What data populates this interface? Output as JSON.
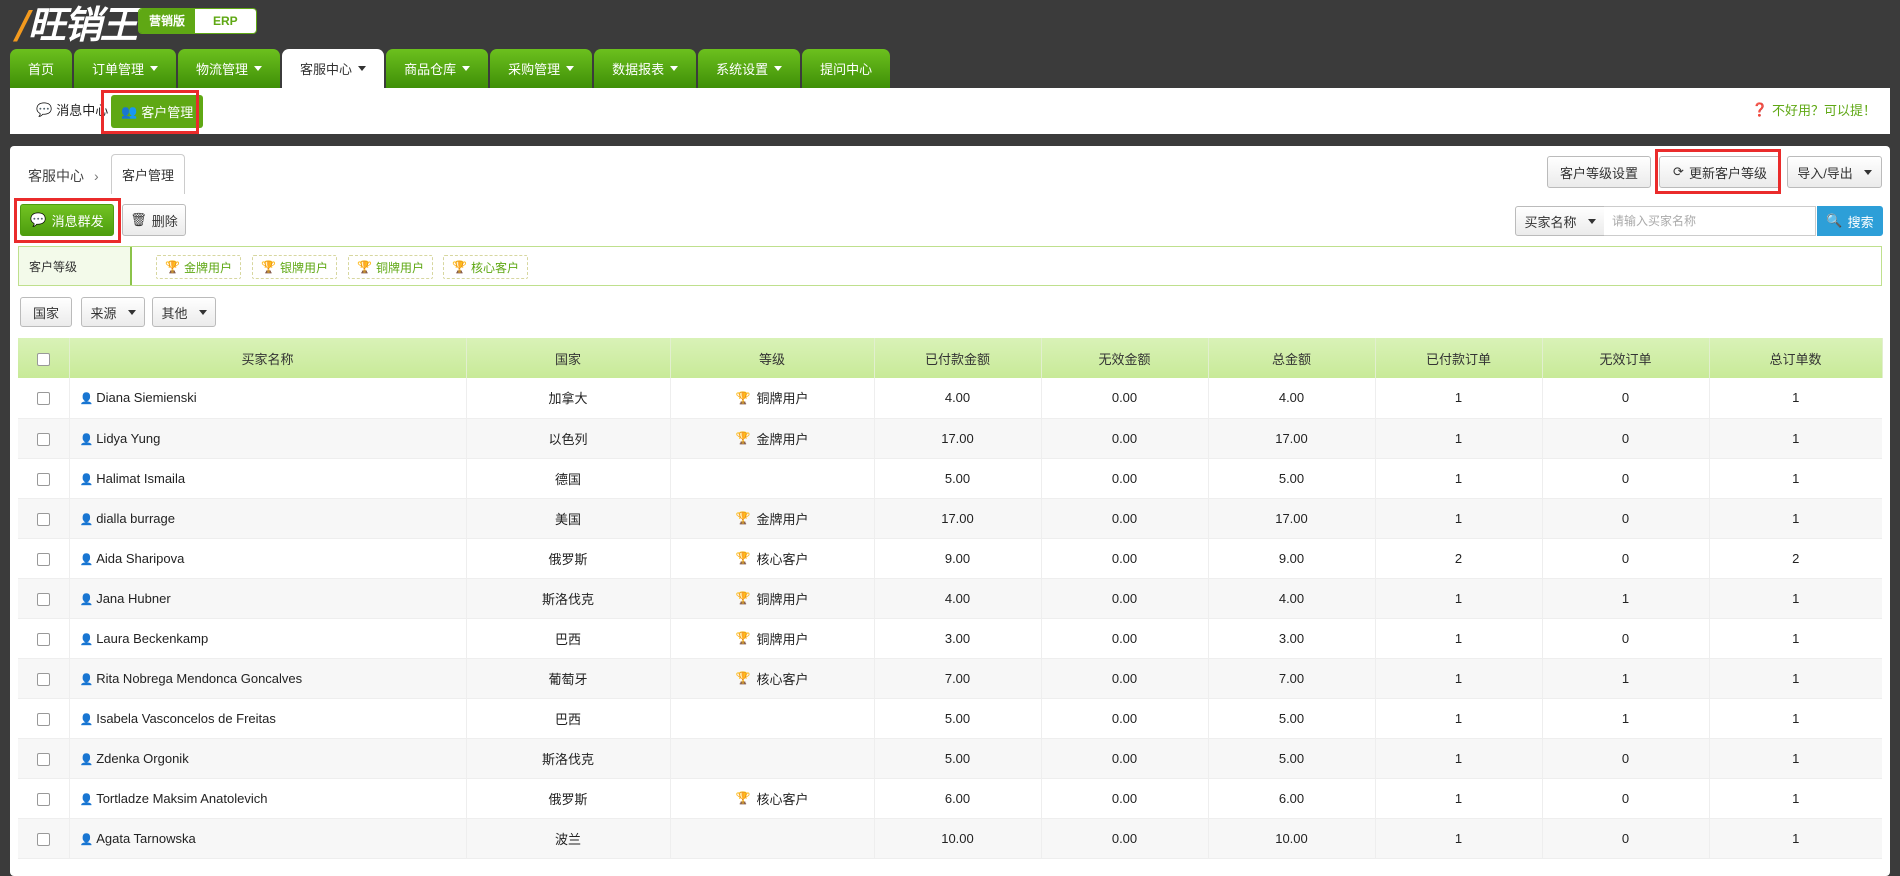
{
  "app": {
    "logo": "旺销王",
    "edition_a": "营销版",
    "edition_b": "ERP"
  },
  "nav": {
    "tabs": [
      {
        "label": "首页",
        "caret": false
      },
      {
        "label": "订单管理",
        "caret": true
      },
      {
        "label": "物流管理",
        "caret": true
      },
      {
        "label": "客服中心",
        "caret": true,
        "active": true
      },
      {
        "label": "商品仓库",
        "caret": true
      },
      {
        "label": "采购管理",
        "caret": true
      },
      {
        "label": "数据报表",
        "caret": true
      },
      {
        "label": "系统设置",
        "caret": true
      },
      {
        "label": "提问中心",
        "caret": false
      }
    ]
  },
  "subnav": {
    "message_center": "消息中心",
    "customer_mgmt": "客户管理",
    "help": "不好用？可以提！"
  },
  "panel": {
    "breadcrumb_root": "客服中心",
    "breadcrumb_sep": "›",
    "breadcrumb_tab": "客户管理",
    "btn_level_settings": "客户等级设置",
    "btn_update_level": "更新客户等级",
    "btn_import_export": "导入/导出",
    "btn_broadcast": "消息群发",
    "btn_delete": "删除",
    "search_field": "买家名称",
    "search_placeholder": "请输入买家名称",
    "btn_search": "搜索",
    "level_label": "客户等级",
    "levels": [
      "金牌用户",
      "银牌用户",
      "铜牌用户",
      "核心客户"
    ],
    "filter_country": "国家",
    "filter_source": "来源",
    "filter_other": "其他"
  },
  "table": {
    "headers": [
      "买家名称",
      "国家",
      "等级",
      "已付款金额",
      "无效金额",
      "总金额",
      "已付款订单",
      "无效订单",
      "总订单数"
    ],
    "rows": [
      [
        "Diana Siemienski",
        "加拿大",
        "铜牌用户",
        "4.00",
        "0.00",
        "4.00",
        "1",
        "0",
        "1"
      ],
      [
        "Lidya Yung",
        "以色列",
        "金牌用户",
        "17.00",
        "0.00",
        "17.00",
        "1",
        "0",
        "1"
      ],
      [
        "Halimat Ismaila",
        "德国",
        "",
        "5.00",
        "0.00",
        "5.00",
        "1",
        "0",
        "1"
      ],
      [
        "dialla burrage",
        "美国",
        "金牌用户",
        "17.00",
        "0.00",
        "17.00",
        "1",
        "0",
        "1"
      ],
      [
        "Aida Sharipova",
        "俄罗斯",
        "核心客户",
        "9.00",
        "0.00",
        "9.00",
        "2",
        "0",
        "2"
      ],
      [
        "Jana Hubner",
        "斯洛伐克",
        "铜牌用户",
        "4.00",
        "0.00",
        "4.00",
        "1",
        "1",
        "1"
      ],
      [
        "Laura Beckenkamp",
        "巴西",
        "铜牌用户",
        "3.00",
        "0.00",
        "3.00",
        "1",
        "0",
        "1"
      ],
      [
        "Rita Nobrega Mendonca Goncalves",
        "葡萄牙",
        "核心客户",
        "7.00",
        "0.00",
        "7.00",
        "1",
        "1",
        "1"
      ],
      [
        "Isabela Vasconcelos de Freitas",
        "巴西",
        "",
        "5.00",
        "0.00",
        "5.00",
        "1",
        "1",
        "1"
      ],
      [
        "Zdenka Orgonik",
        "斯洛伐克",
        "",
        "5.00",
        "0.00",
        "5.00",
        "1",
        "0",
        "1"
      ],
      [
        "Tortladze Maksim Anatolevich",
        "俄罗斯",
        "核心客户",
        "6.00",
        "0.00",
        "6.00",
        "1",
        "0",
        "1"
      ],
      [
        "Agata Tarnowska",
        "波兰",
        "",
        "10.00",
        "0.00",
        "10.00",
        "1",
        "0",
        "1"
      ]
    ]
  },
  "colors": {
    "brand_green": "#5fa814",
    "highlight_red": "#ea2b2b",
    "search_blue": "#2d9fd8"
  }
}
